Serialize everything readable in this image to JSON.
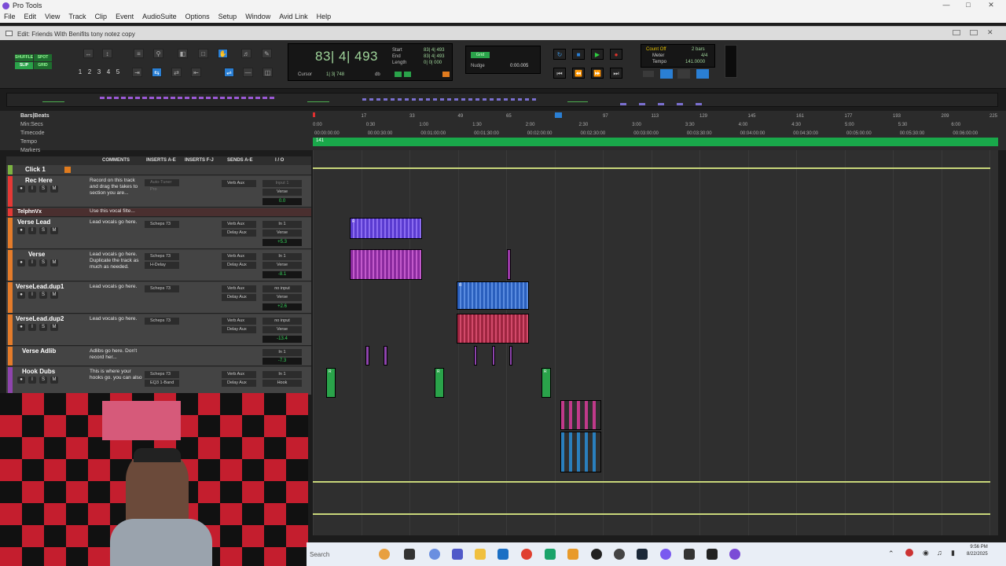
{
  "window": {
    "title": "Pro Tools"
  },
  "menu": [
    "File",
    "Edit",
    "View",
    "Track",
    "Clip",
    "Event",
    "AudioSuite",
    "Options",
    "Setup",
    "Window",
    "Avid Link",
    "Help"
  ],
  "document": {
    "title": "Edit: Friends With Benifits tony notez copy"
  },
  "transport": {
    "modes": [
      "SHUFFLE",
      "SPOT",
      "SLIP",
      "GRID"
    ],
    "zoom_presets": [
      "1",
      "2",
      "3",
      "4",
      "5"
    ],
    "main_counter": "83| 4| 493",
    "start_label": "Start",
    "start_value": "83| 4| 493",
    "end_label": "End",
    "end_value": "83| 4| 493",
    "length_label": "Length",
    "length_value": "0| 0| 000",
    "cursor_label": "Cursor",
    "cursor_value": "1| 3| 748",
    "cursor_db": "db",
    "grid_label": "Grid",
    "nudge_label": "Nudge",
    "nudge_value": "0:00.005",
    "count_off": "Count Off",
    "meter_label": "Meter",
    "meter_value": "4/4",
    "tempo_label": "Tempo",
    "tempo_value": "141.0000",
    "bars_value": "2 bars"
  },
  "rulers": {
    "labels": [
      "Bars|Beats",
      "Min:Secs",
      "Timecode",
      "Tempo",
      "Markers"
    ],
    "bars": [
      "1",
      "17",
      "33",
      "49",
      "65",
      "81",
      "97",
      "113",
      "129",
      "145",
      "161",
      "177",
      "193",
      "209",
      "225"
    ],
    "minsecs": [
      "0:00",
      "0:30",
      "1:00",
      "1:30",
      "2:00",
      "2:30",
      "3:00",
      "3:30",
      "4:00",
      "4:30",
      "5:00",
      "5:30",
      "6:00"
    ],
    "timecode": [
      "00:00:00:00",
      "00:00:30:00",
      "00:01:00:00",
      "00:01:30:00",
      "00:02:00:00",
      "00:02:30:00",
      "00:03:00:00",
      "00:03:30:00",
      "00:04:00:00",
      "00:04:30:00",
      "00:05:00:00",
      "00:05:30:00",
      "00:06:00:00"
    ],
    "tempo_marker": "141"
  },
  "columns": [
    "COMMENTS",
    "INSERTS A-E",
    "INSERTS F-J",
    "SENDS A-E",
    "I / O"
  ],
  "tracks": [
    {
      "name": "Click 1",
      "comment": "",
      "color": "#7cb342"
    },
    {
      "name": "Rec Here",
      "comment": "Record on this track and drag the takes to section you are...",
      "insert": "Auto-Tuner Pro",
      "send": "Verb Aux",
      "send2": "",
      "io_in": "Input 1",
      "io_out": "Verse",
      "vol": "0.0",
      "pan": "0",
      "color": "#e53935"
    },
    {
      "name": "TelphnVx",
      "comment": "Use this vocal filte...",
      "color": "#e53935"
    },
    {
      "name": "Verse Lead",
      "comment": "Lead vocals go here.",
      "insert": "Scheps 73",
      "send": "Verb Aux",
      "send2": "Delay Aux",
      "io_in": "In 1",
      "io_out": "Verse",
      "vol": "+5.3",
      "pan": "0",
      "color": "#e57c2a"
    },
    {
      "name": "Verse",
      "comment": "Lead vocals go here. Duplicate the track as much as needed.",
      "insert": "Scheps 73",
      "insert2": "H-Delay",
      "send": "Verb Aux",
      "send2": "Delay Aux",
      "io_in": "In 1",
      "io_out": "Verse",
      "vol": "-8.1",
      "pan": "0",
      "color": "#e57c2a"
    },
    {
      "name": "VerseLead.dup1",
      "comment": "Lead vocals go here.",
      "insert": "Scheps 73",
      "send": "Verb Aux",
      "send2": "Delay Aux",
      "io_in": "no input",
      "io_out": "Verse",
      "vol": "+2.6",
      "pan": "0",
      "color": "#e57c2a"
    },
    {
      "name": "VerseLead.dup2",
      "comment": "Lead vocals go here.",
      "insert": "Scheps 73",
      "send": "Verb Aux",
      "send2": "Delay Aux",
      "io_in": "no input",
      "io_out": "Verse",
      "vol": "-13.4",
      "pan": "0",
      "color": "#e57c2a"
    },
    {
      "name": "Verse Adlib",
      "comment": "Adlibs go here. Don't record her...",
      "io_in": "In 1",
      "io_out": "Verse",
      "vol": "-7.3",
      "pan": "P",
      "color": "#e57c2a"
    },
    {
      "name": "Hook Dubs",
      "comment": "This is where your hooks go. you can also",
      "insert": "Scheps 73",
      "insert2": "EQ3 1-Band",
      "send": "Verb Aux",
      "send2": "Delay Aux",
      "io_in": "In 1",
      "io_out": "Hook",
      "vol": "",
      "color": "#8e44ad"
    }
  ],
  "clip_label": "R",
  "taskbar": {
    "search": "Search",
    "time": "9:56 PM",
    "date": "8/22/2025"
  }
}
